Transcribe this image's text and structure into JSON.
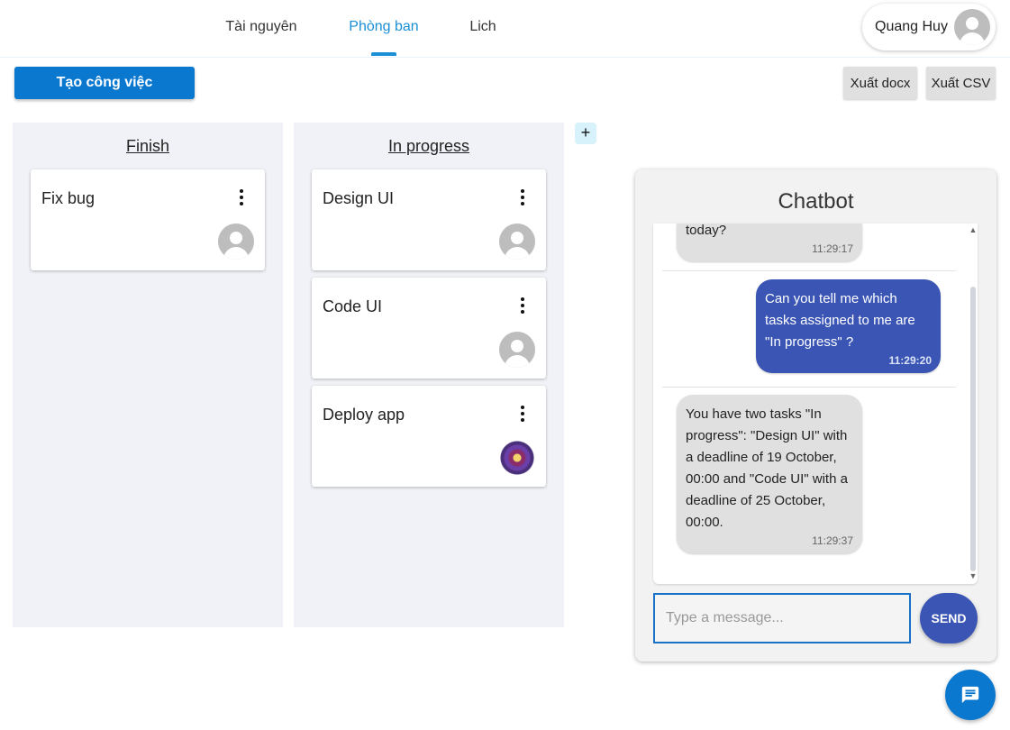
{
  "nav": {
    "tabs": [
      {
        "label": "Tài nguyên"
      },
      {
        "label": "Phòng ban",
        "active": true
      },
      {
        "label": "Lich"
      }
    ],
    "user_name": "Quang Huy"
  },
  "toolbar": {
    "create_label": "Tạo công việc",
    "export_docx_label": "Xuất docx",
    "export_csv_label": "Xuất CSV"
  },
  "board": {
    "columns": [
      {
        "title": "Finish",
        "cards": [
          {
            "title": "Fix bug",
            "assignee_icon": "default-avatar"
          }
        ]
      },
      {
        "title": "In progress",
        "cards": [
          {
            "title": "Design UI",
            "assignee_icon": "default-avatar"
          },
          {
            "title": "Code UI",
            "assignee_icon": "default-avatar"
          },
          {
            "title": "Deploy app",
            "assignee_icon": "flower-avatar"
          }
        ]
      }
    ],
    "add_column_label": "+"
  },
  "chatbot": {
    "title": "Chatbot",
    "messages": [
      {
        "from": "bot",
        "text": "today?",
        "time": "11:29:17"
      },
      {
        "from": "user",
        "text": "Can you tell me which tasks assigned to me are \"In progress\" ?",
        "time": "11:29:20"
      },
      {
        "from": "bot",
        "text": "You have two tasks \"In progress\": \"Design UI\" with a deadline of 19 October, 00:00 and \"Code UI\" with a deadline of 25 October, 00:00.",
        "time": "11:29:37"
      }
    ],
    "input_placeholder": "Type a message...",
    "send_label": "SEND"
  },
  "colors": {
    "primary": "#0b78d0",
    "accent": "#1a8fd6",
    "user_bubble": "#3a55b4",
    "bot_bubble": "#e0e0e0",
    "column_bg": "#f0f2f7"
  }
}
